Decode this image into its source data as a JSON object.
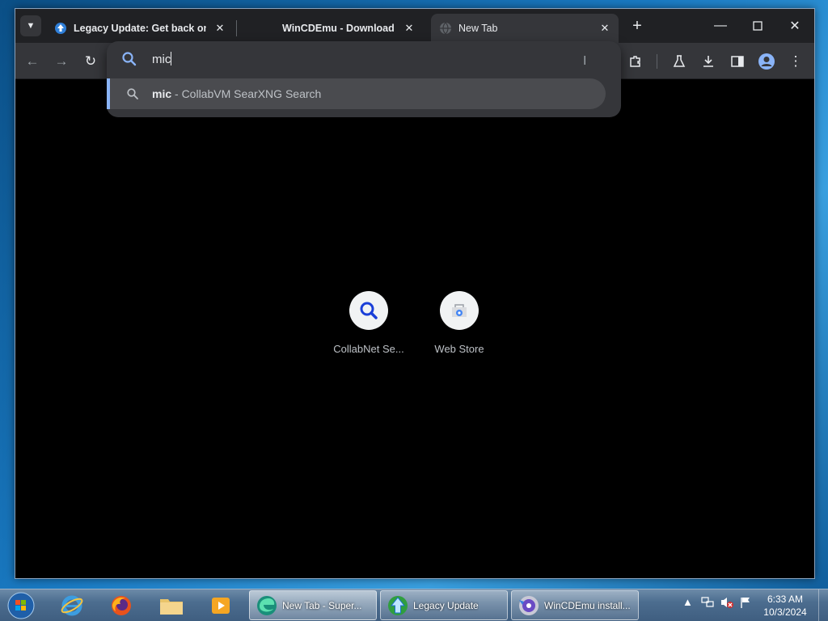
{
  "tabs": [
    {
      "title": "Legacy Update: Get back online",
      "active": false
    },
    {
      "title": "WinCDEmu - Download",
      "active": false
    },
    {
      "title": "New Tab",
      "active": true
    }
  ],
  "omnibox": {
    "typed_text": "mic",
    "suggestion_query": "mic",
    "suggestion_suffix": " - CollabVM SearXNG Search"
  },
  "shortcuts": [
    {
      "label": "CollabNet Se...",
      "icon": "search-icon"
    },
    {
      "label": "Web Store",
      "icon": "web-store-icon"
    }
  ],
  "taskbar": {
    "tasks": [
      {
        "label": "New Tab - Super...",
        "icon": "edge-icon",
        "active": true
      },
      {
        "label": "Legacy Update",
        "icon": "legacy-update-icon",
        "active": false
      },
      {
        "label": "WinCDEmu install...",
        "icon": "wincdemu-icon",
        "active": false
      }
    ],
    "clock": {
      "time": "6:33 AM",
      "date": "10/3/2024"
    }
  },
  "colors": {
    "accent": "#8ab4f8",
    "tabstrip": "#202124",
    "toolbar": "#35363a",
    "content": "#000000"
  }
}
